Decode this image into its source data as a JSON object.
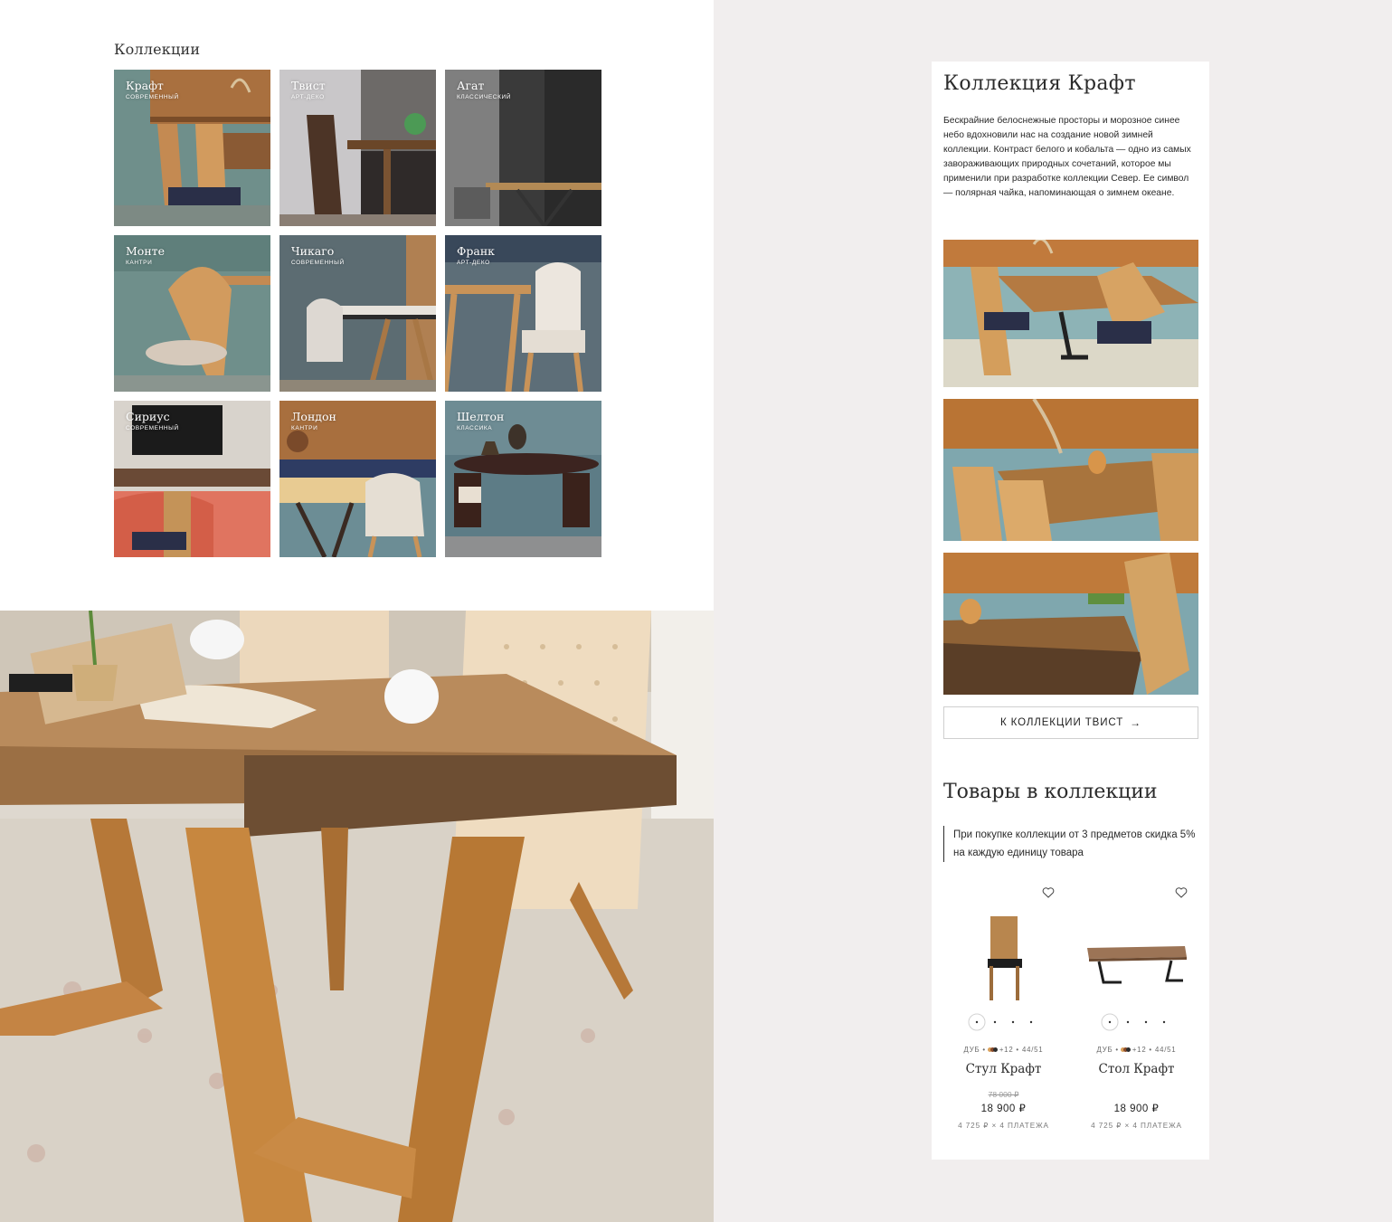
{
  "collections": {
    "title": "Коллекции",
    "items": [
      {
        "name": "Крафт",
        "style": "современный"
      },
      {
        "name": "Твист",
        "style": "арт-деко"
      },
      {
        "name": "Агат",
        "style": "классический"
      },
      {
        "name": "Монте",
        "style": "кантри"
      },
      {
        "name": "Чикаго",
        "style": "современный"
      },
      {
        "name": "Франк",
        "style": "арт-деко"
      },
      {
        "name": "Сириус",
        "style": "современный"
      },
      {
        "name": "Лондон",
        "style": "кантри"
      },
      {
        "name": "Шелтон",
        "style": "классика"
      }
    ]
  },
  "collection_page": {
    "title": "Коллекция Крафт",
    "description": "Бескрайние белоснежные просторы и морозное синее небо вдохновили нас на создание новой зимней коллекции. Контраст белого  и кобальта — одно из самых завораживающих природных сочетаний, которое мы применили при разработке коллекции Север. Ее символ — полярная чайка, напоминающая о зимнем океане.",
    "next_button_label": "К КОЛЛЕКЦИИ ТВИСТ",
    "next_button_icon": "arrow-right-icon",
    "products_title": "Товары в коллекции",
    "promo": "При покупке коллекции от 3 предметов скидка 5% на каждую единицу товара",
    "products": [
      {
        "name": "Стул Крафт",
        "material": "ДУБ",
        "colors_extra": "+12",
        "size": "44/51",
        "old_price": "78 000 ₽",
        "price": "18 900 ₽",
        "installment": "4 725 ₽ × 4 ПЛАТЕЖА"
      },
      {
        "name": "Стол Крафт",
        "material": "ДУБ",
        "colors_extra": "+12",
        "size": "44/51",
        "old_price": "",
        "price": "18 900 ₽",
        "installment": "4 725 ₽ × 4 ПЛАТЕЖА"
      }
    ],
    "swatch_colors": [
      "#d9a05a",
      "#8a4a2a",
      "#2c2c2c"
    ]
  },
  "colors": {
    "page_background": "#f1eeee",
    "panel_background": "#ffffff",
    "text": "#1f1f1f"
  }
}
